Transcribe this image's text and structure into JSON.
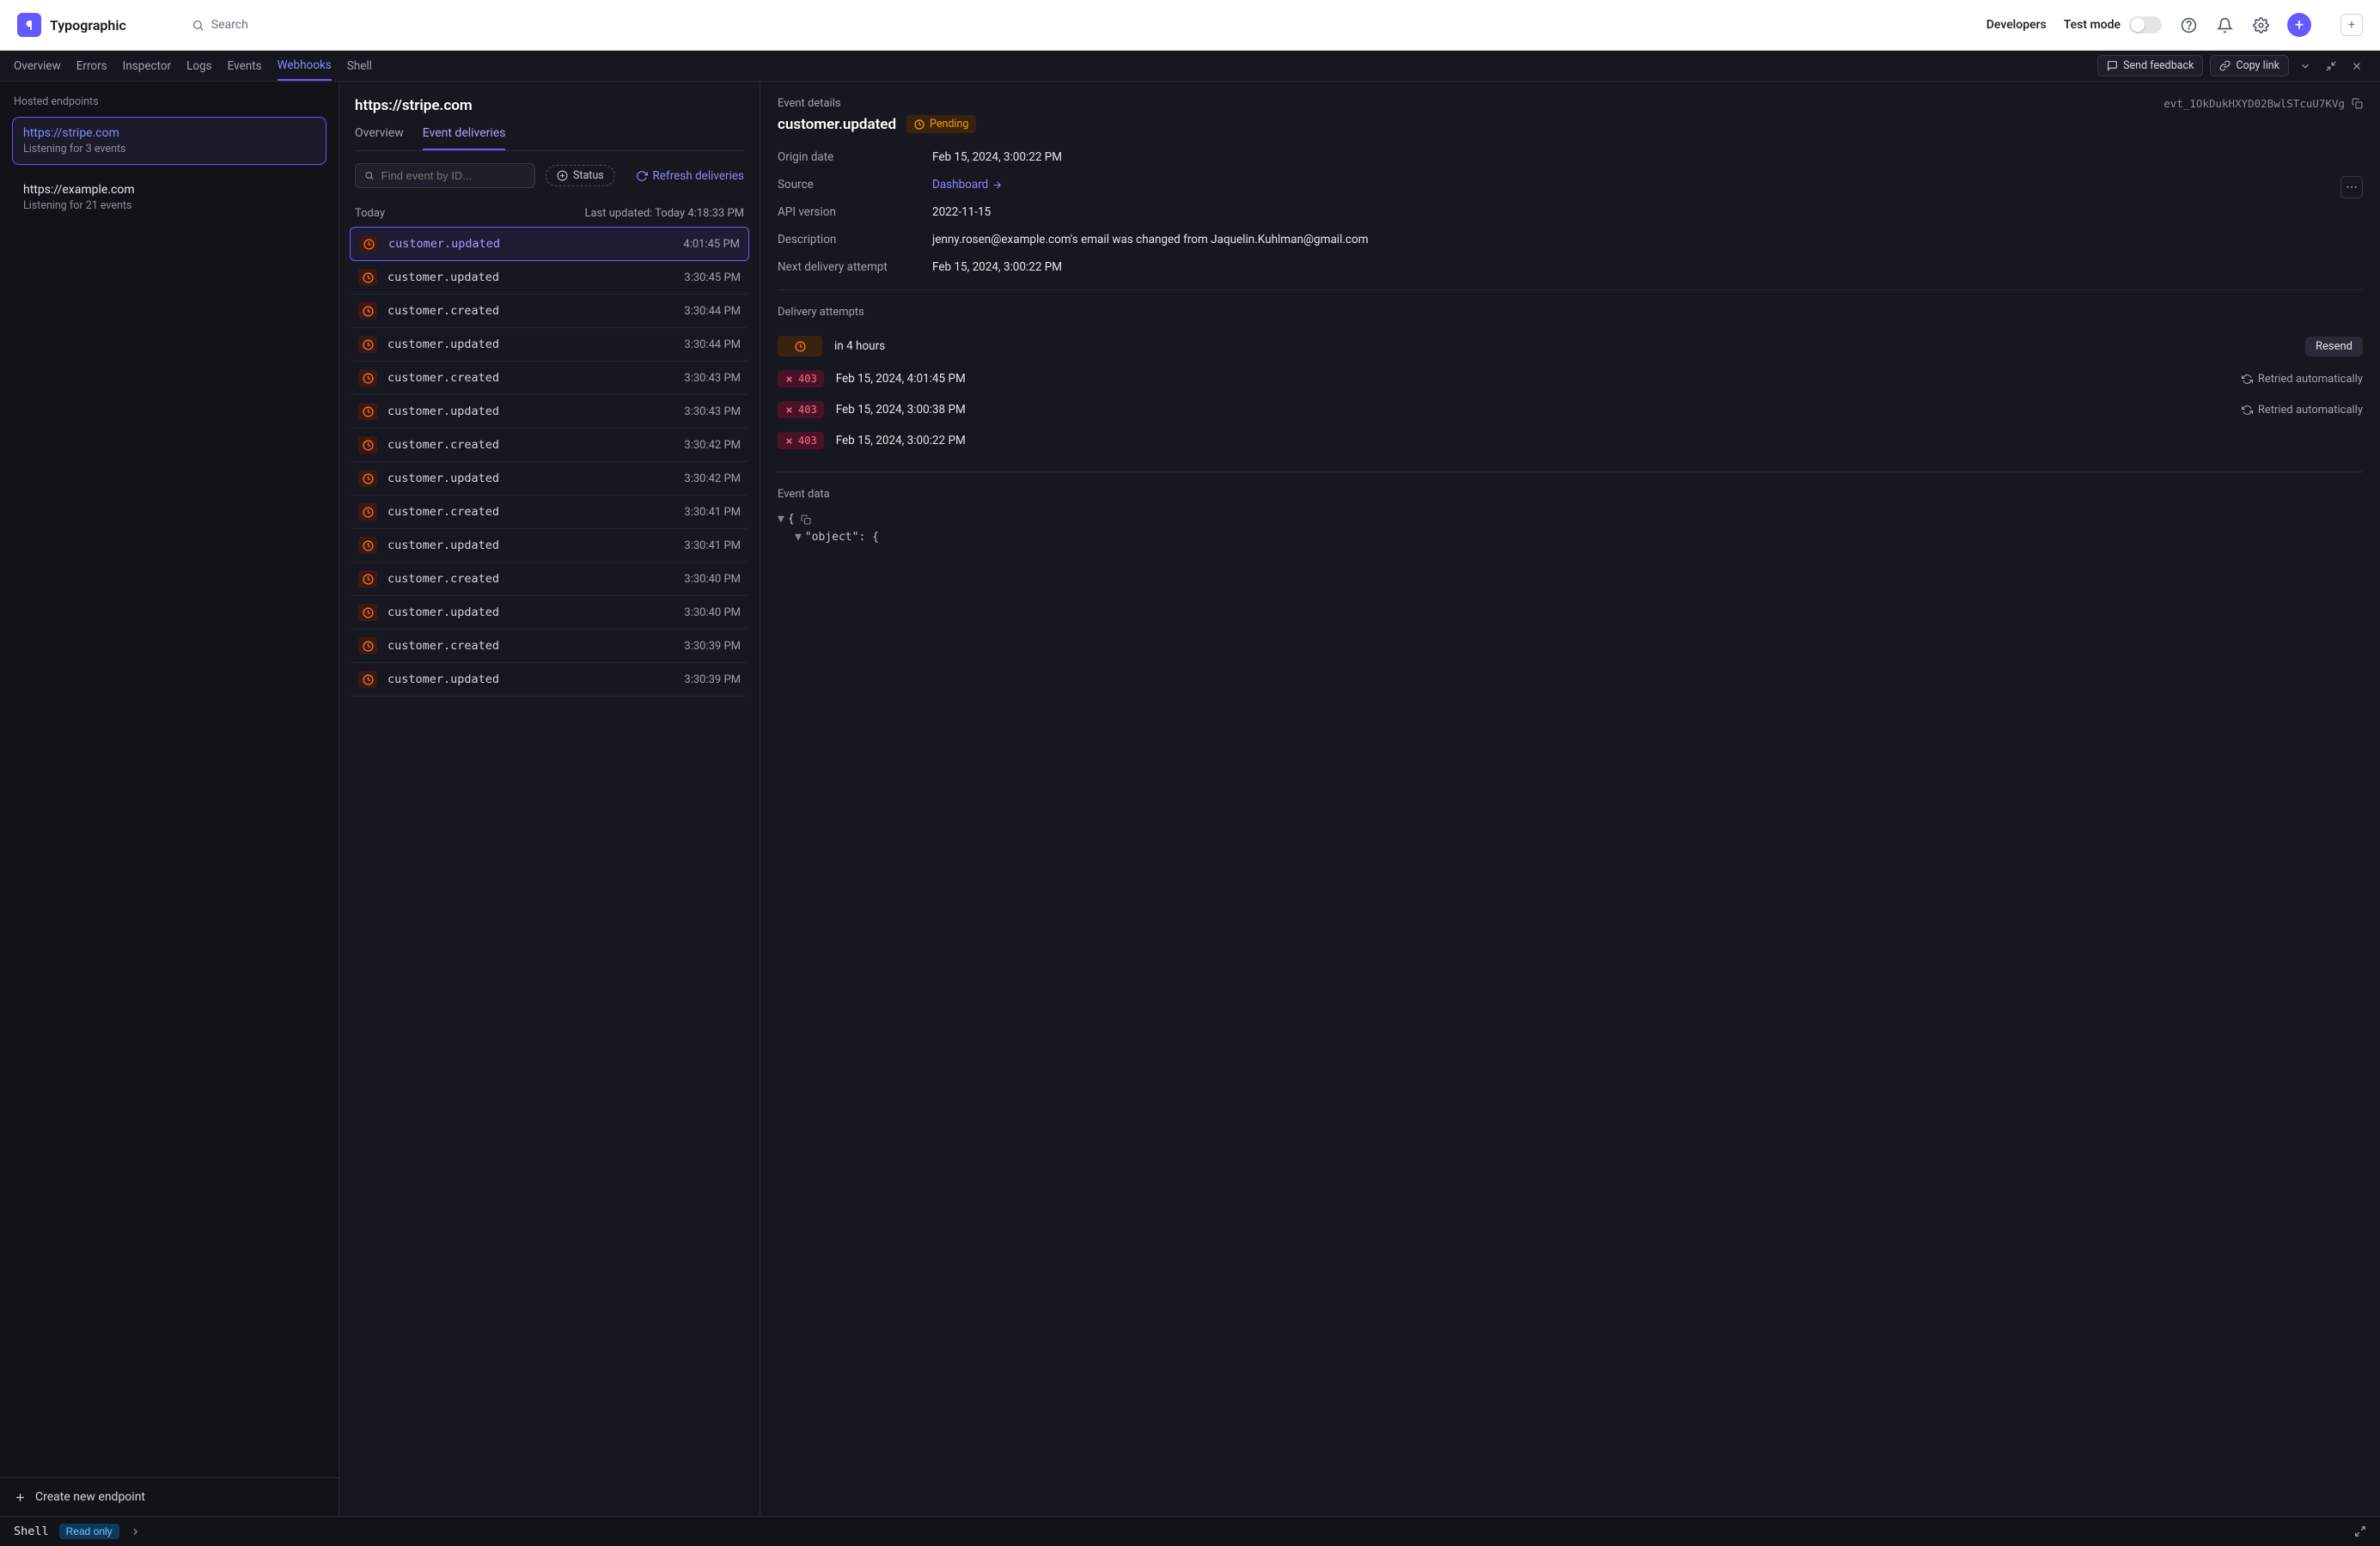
{
  "brand": "Typographic",
  "search_placeholder": "Search",
  "top": {
    "developers": "Developers",
    "test_mode": "Test mode"
  },
  "tabs": [
    "Overview",
    "Errors",
    "Inspector",
    "Logs",
    "Events",
    "Webhooks",
    "Shell"
  ],
  "active_tab": "Webhooks",
  "tabbar_buttons": {
    "feedback": "Send feedback",
    "copy": "Copy link"
  },
  "sidebar": {
    "section": "Hosted endpoints",
    "endpoints": [
      {
        "url": "https://stripe.com",
        "sub": "Listening for 3 events",
        "active": true
      },
      {
        "url": "https://example.com",
        "sub": "Listening for 21 events",
        "active": false
      }
    ],
    "create": "Create new endpoint"
  },
  "middle": {
    "title": "https://stripe.com",
    "subtabs": [
      "Overview",
      "Event deliveries"
    ],
    "active_subtab": "Event deliveries",
    "find_placeholder": "Find event by ID...",
    "status_label": "Status",
    "refresh": "Refresh deliveries",
    "today": "Today",
    "last_updated": "Last updated: Today 4:18:33 PM",
    "events": [
      {
        "name": "customer.updated",
        "time": "4:01:45 PM",
        "selected": true
      },
      {
        "name": "customer.updated",
        "time": "3:30:45 PM"
      },
      {
        "name": "customer.created",
        "time": "3:30:44 PM"
      },
      {
        "name": "customer.updated",
        "time": "3:30:44 PM"
      },
      {
        "name": "customer.created",
        "time": "3:30:43 PM"
      },
      {
        "name": "customer.updated",
        "time": "3:30:43 PM"
      },
      {
        "name": "customer.created",
        "time": "3:30:42 PM"
      },
      {
        "name": "customer.updated",
        "time": "3:30:42 PM"
      },
      {
        "name": "customer.created",
        "time": "3:30:41 PM"
      },
      {
        "name": "customer.updated",
        "time": "3:30:41 PM"
      },
      {
        "name": "customer.created",
        "time": "3:30:40 PM"
      },
      {
        "name": "customer.updated",
        "time": "3:30:40 PM"
      },
      {
        "name": "customer.created",
        "time": "3:30:39 PM"
      },
      {
        "name": "customer.updated",
        "time": "3:30:39 PM"
      }
    ]
  },
  "detail": {
    "header_label": "Event details",
    "event_id": "evt_1OkDukHXYD02BwlSTcuU7KVg",
    "event_type": "customer.updated",
    "status_badge": "Pending",
    "fields": {
      "origin_date_k": "Origin date",
      "origin_date_v": "Feb 15, 2024, 3:00:22 PM",
      "source_k": "Source",
      "source_v": "Dashboard",
      "api_version_k": "API version",
      "api_version_v": "2022-11-15",
      "description_k": "Description",
      "description_v": "jenny.rosen@example.com's email was changed from Jaquelin.Kuhlman@gmail.com",
      "next_attempt_k": "Next delivery attempt",
      "next_attempt_v": "Feb 15, 2024, 3:00:22 PM"
    },
    "attempts_title": "Delivery attempts",
    "attempts": [
      {
        "badge": "pending",
        "text": "in 4 hours",
        "meta": "",
        "resend": "Resend"
      },
      {
        "badge": "403",
        "text": "Feb 15, 2024, 4:01:45 PM",
        "meta": "Retried automatically"
      },
      {
        "badge": "403",
        "text": "Feb 15, 2024, 3:00:38 PM",
        "meta": "Retried automatically"
      },
      {
        "badge": "403",
        "text": "Feb 15, 2024, 3:00:22 PM",
        "meta": ""
      }
    ],
    "event_data_title": "Event data",
    "json_lines": [
      "{",
      "\"object\": {"
    ]
  },
  "shell": {
    "label": "Shell",
    "badge": "Read only"
  }
}
